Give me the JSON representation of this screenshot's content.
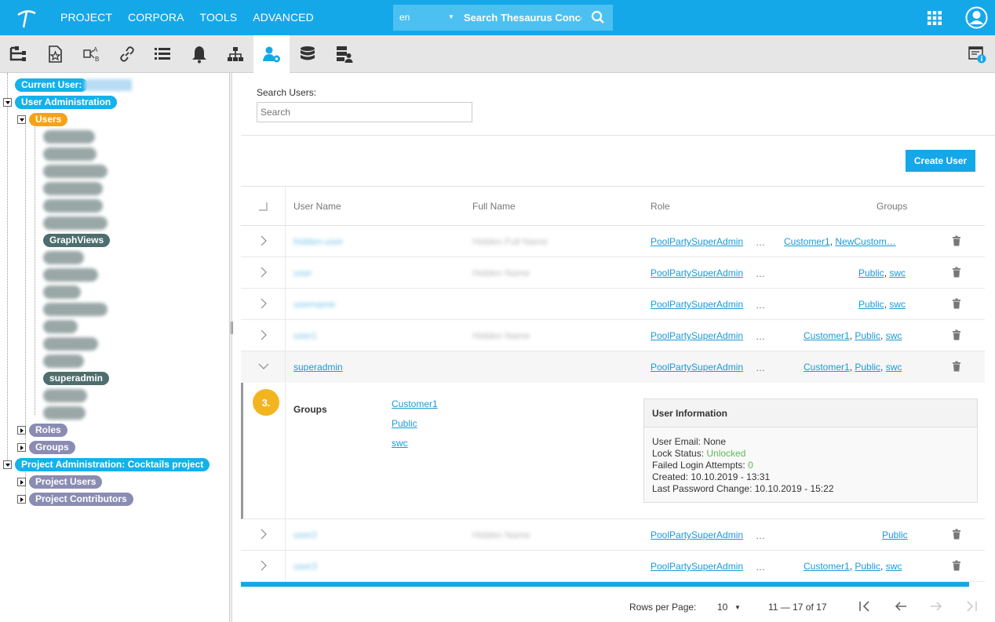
{
  "nav": {
    "menu": [
      "PROJECT",
      "CORPORA",
      "TOOLS",
      "ADVANCED"
    ],
    "lang": "en",
    "search_placeholder": "Search Thesaurus Conce"
  },
  "toolbar": {
    "icons": [
      "hierarchy-icon",
      "document-star-icon",
      "ab-mapping-icon",
      "link-icon",
      "list-icon",
      "bell-icon",
      "org-chart-icon",
      "user-admin-icon",
      "database-icon",
      "server-user-icon"
    ],
    "active": "user-admin-icon",
    "accent": "#15a8e8"
  },
  "tree": {
    "current_user": "Current User:",
    "user_admin": "User Administration",
    "users": "Users",
    "graphviews": "GraphViews",
    "superadmin": "superadmin",
    "roles": "Roles",
    "groups": "Groups",
    "project_admin": "Project Administration: Cocktails project",
    "project_users": "Project Users",
    "project_contributors": "Project Contributors"
  },
  "main": {
    "search_label": "Search Users:",
    "search_placeholder": "Search",
    "create_button": "Create User",
    "columns": [
      "User Name",
      "Full Name",
      "Role",
      "Groups"
    ],
    "rows": [
      {
        "user": "",
        "full": "",
        "role": "PoolPartySuperAdmin",
        "groups": "Customer1, NewCustom…",
        "g": [
          "Customer1",
          "NewCustom…"
        ]
      },
      {
        "user": "",
        "full": "",
        "role": "PoolPartySuperAdmin",
        "g": [
          "Public",
          "swc"
        ]
      },
      {
        "user": "",
        "full": "",
        "role": "PoolPartySuperAdmin",
        "g": [
          "Public",
          "swc"
        ]
      },
      {
        "user": "",
        "full": "",
        "role": "PoolPartySuperAdmin",
        "g": [
          "Customer1",
          "Public",
          "swc"
        ]
      },
      {
        "user": "superadmin",
        "full": "",
        "role": "PoolPartySuperAdmin",
        "g": [
          "Customer1",
          "Public",
          "swc"
        ]
      },
      {
        "user": "",
        "full": "",
        "role": "PoolPartySuperAdmin",
        "g": [
          "Public"
        ]
      },
      {
        "user": "",
        "full": "",
        "role": "PoolPartySuperAdmin",
        "g": [
          "Customer1",
          "Public",
          "swc"
        ]
      }
    ],
    "ellipsis": "…",
    "detail": {
      "badge": "3.",
      "groups_label": "Groups",
      "groups": [
        "Customer1",
        "Public",
        "swc"
      ],
      "info_title": "User Information",
      "email": "User Email: None",
      "lock_label": "Lock Status: ",
      "lock_value": "Unlocked",
      "failed_label": "Failed Login Attempts: ",
      "failed_value": "0",
      "created": "Created: 10.10.2019 - 13:31",
      "last_change": "Last Password Change: 10.10.2019 - 15:22"
    },
    "pager": {
      "rows_label": "Rows per Page:",
      "rows_value": "10",
      "range": "11 — 17 of 17"
    }
  }
}
